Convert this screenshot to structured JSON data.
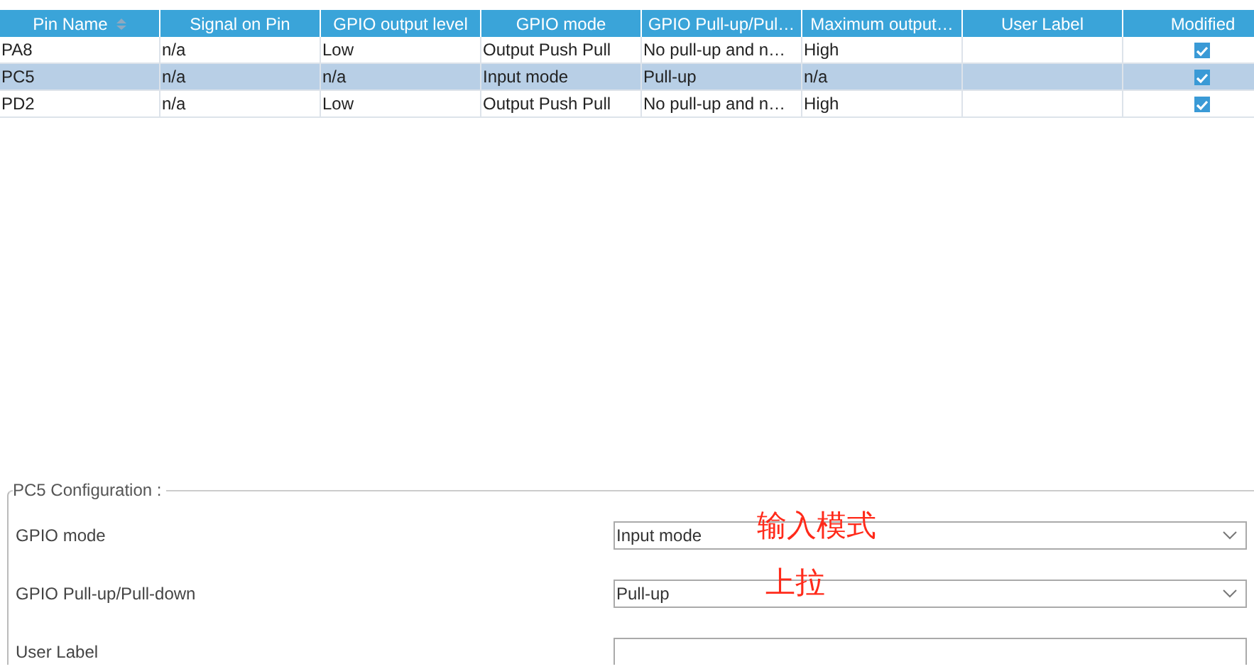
{
  "table": {
    "columns": [
      {
        "label": "Pin Name",
        "sorted": true
      },
      {
        "label": "Signal on Pin",
        "sorted": false
      },
      {
        "label": "GPIO output level",
        "sorted": false
      },
      {
        "label": "GPIO mode",
        "sorted": false
      },
      {
        "label": "GPIO Pull-up/Pul…",
        "sorted": false
      },
      {
        "label": "Maximum output…",
        "sorted": false
      },
      {
        "label": "User Label",
        "sorted": false
      },
      {
        "label": "Modified",
        "sorted": false
      }
    ],
    "rows": [
      {
        "selected": false,
        "cells": [
          "PA8",
          "n/a",
          "Low",
          "Output Push Pull",
          "No pull-up and n…",
          "High",
          null
        ],
        "modified": true
      },
      {
        "selected": true,
        "cells": [
          "PC5",
          "n/a",
          "n/a",
          "Input mode",
          "Pull-up",
          "n/a",
          null
        ],
        "modified": true
      },
      {
        "selected": false,
        "cells": [
          "PD2",
          "n/a",
          "Low",
          "Output Push Pull",
          "No pull-up and n…",
          "High",
          null
        ],
        "modified": true
      }
    ]
  },
  "config": {
    "title": "PC5 Configuration :",
    "fields": [
      {
        "kind": "dropdown",
        "label": "GPIO mode",
        "value": "Input mode",
        "annotation": "输入模式"
      },
      {
        "kind": "dropdown",
        "label": "GPIO Pull-up/Pull-down",
        "value": "Pull-up",
        "annotation": "上拉"
      },
      {
        "kind": "text",
        "label": "User Label"
      }
    ]
  }
}
